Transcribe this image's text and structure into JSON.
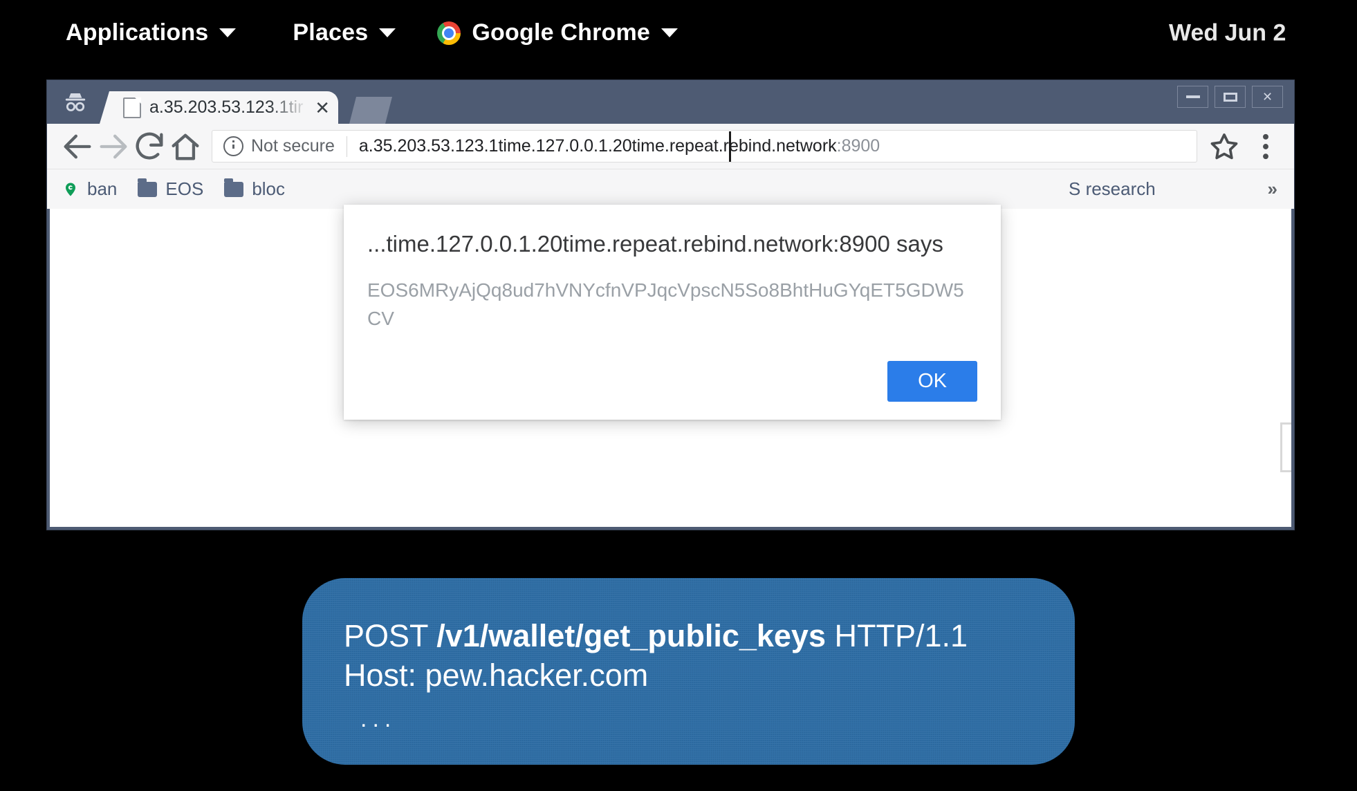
{
  "desktop": {
    "panel": {
      "applications": "Applications",
      "places": "Places",
      "chrome": "Google Chrome",
      "chrome_icon": "chrome-logo-icon",
      "clock": "Wed Jun 2"
    }
  },
  "browser": {
    "incognito_icon": "incognito-icon",
    "window_controls": {
      "minimize": "–",
      "maximize": "□",
      "close": "✕"
    },
    "tab": {
      "title": "a.35.203.53.123.1tir",
      "favicon": "page-icon",
      "close": "✕"
    },
    "toolbar": {
      "back_icon": "back-arrow-icon",
      "forward_icon": "forward-arrow-icon",
      "reload_icon": "reload-icon",
      "home_icon": "home-icon",
      "security_label": "Not secure",
      "security_icon": "info-circle-icon",
      "url": "a.35.203.53.123.1time.127.0.0.1.20time.repeat.rebind.network",
      "url_port": ":8900",
      "bookmark_icon": "star-outline-icon",
      "menu_icon": "three-dot-menu-icon"
    },
    "bookmarks": {
      "items": [
        {
          "label": "ban",
          "icon": "pin-icon"
        },
        {
          "label": "EOS",
          "icon": "folder-icon"
        },
        {
          "label": "bloc",
          "icon": "folder-icon"
        }
      ],
      "right_item": "S research",
      "overflow": "»"
    }
  },
  "dialog": {
    "title": "...time.127.0.0.1.20time.repeat.rebind.network:8900 says",
    "message": "EOS6MRyAjQq8ud7hVNYcfnVPJqcVpscN5So8BhtHuGYqET5GDW5CV",
    "ok_label": "OK",
    "ok_color": "#2b7de9"
  },
  "callout": {
    "request_method": "POST ",
    "request_path": "/v1/wallet/get_public_keys",
    "request_version": " HTTP/1.1",
    "host_line": "Host: pew.hacker.com",
    "ellipsis": "...",
    "background_color": "#2e6da4"
  }
}
